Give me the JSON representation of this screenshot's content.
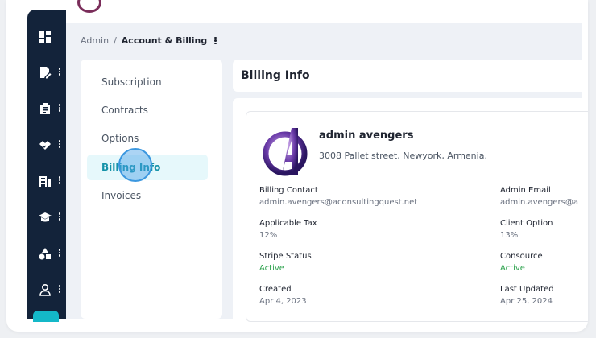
{
  "breadcrumb": {
    "root": "Admin",
    "separator": "/",
    "current": "Account & Billing"
  },
  "sidebar_icons": [
    "dashboard-icon",
    "edit-document-icon",
    "clipboard-icon",
    "handshake-icon",
    "building-icon",
    "graduation-cap-icon",
    "shapes-icon",
    "user-icon"
  ],
  "menu": {
    "items": [
      {
        "label": "Subscription",
        "active": false
      },
      {
        "label": "Contracts",
        "active": false
      },
      {
        "label": "Options",
        "active": false
      },
      {
        "label": "Billing Info",
        "active": true
      },
      {
        "label": "Invoices",
        "active": false
      }
    ]
  },
  "billing": {
    "title": "Billing Info",
    "company": {
      "name": "admin avengers",
      "address": "3008 Pallet street, Newyork, Armenia."
    },
    "fields": {
      "billing_contact": {
        "label": "Billing Contact",
        "value": "admin.avengers@aconsultingquest.net"
      },
      "admin_email": {
        "label": "Admin Email",
        "value": "admin.avengers@a"
      },
      "applicable_tax": {
        "label": "Applicable Tax",
        "value": "12%"
      },
      "client_option": {
        "label": "Client Option",
        "value": "13%"
      },
      "stripe_status": {
        "label": "Stripe Status",
        "value": "Active"
      },
      "consource": {
        "label": "Consource",
        "value": "Active"
      },
      "created": {
        "label": "Created",
        "value": "Apr 4, 2023"
      },
      "last_updated": {
        "label": "Last Updated",
        "value": "Apr 25, 2024"
      }
    }
  },
  "colors": {
    "rail": "#13233a",
    "accent": "#14b8c8",
    "active_text": "#1592a8",
    "status_green": "#2fa34f"
  }
}
